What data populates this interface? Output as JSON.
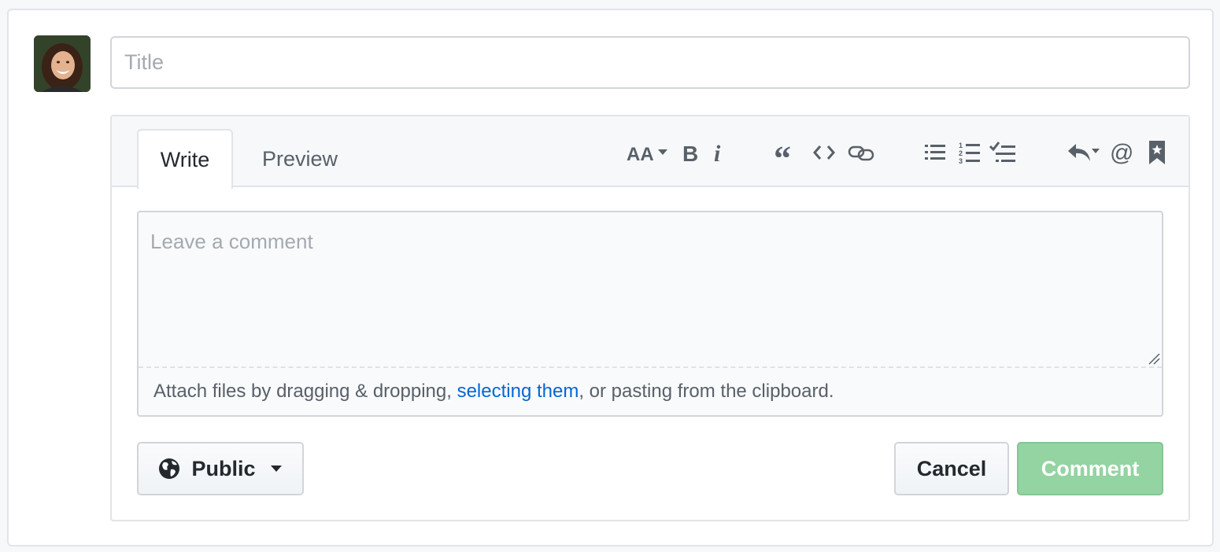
{
  "form": {
    "title_placeholder": "Title",
    "title_value": ""
  },
  "tabs": [
    {
      "label": "Write",
      "active": true
    },
    {
      "label": "Preview",
      "active": false
    }
  ],
  "toolbar": {
    "icons": [
      "text-size-icon",
      "bold-icon",
      "italic-icon",
      "quote-icon",
      "code-icon",
      "link-icon",
      "bulleted-list-icon",
      "numbered-list-icon",
      "task-list-icon",
      "reply-icon",
      "mention-icon",
      "bookmark-icon"
    ]
  },
  "comment": {
    "placeholder": "Leave a comment",
    "value": "",
    "attach_prefix": "Attach files by dragging & dropping, ",
    "attach_link": "selecting them",
    "attach_suffix": ", or pasting from the clipboard."
  },
  "footer": {
    "visibility_label": "Public",
    "cancel_label": "Cancel",
    "comment_label": "Comment"
  },
  "colors": {
    "link": "#0366d6",
    "primary_disabled": "#94d3a2",
    "border": "#e1e4e8"
  }
}
